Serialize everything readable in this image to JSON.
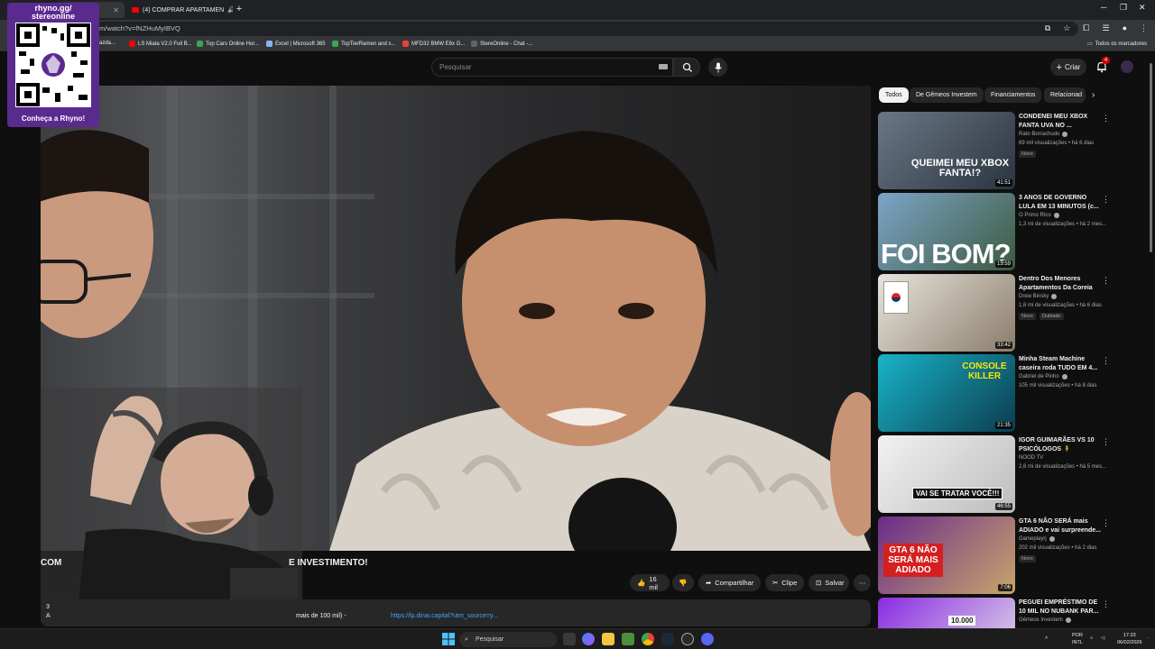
{
  "browser": {
    "tabs": [
      {
        "label": "",
        "active": true
      },
      {
        "label": "(4) COMPRAR APARTAMEN",
        "active": false
      }
    ],
    "url": "m/watch?v=fNZHuMyIBVQ",
    "bookmarks": [
      {
        "label": "azda...",
        "color": "#4285f4"
      },
      {
        "label": "LS Miata V2.0 Full B...",
        "color": "#ff0000"
      },
      {
        "label": "Top Cars Online Hor...",
        "color": "#34a853"
      },
      {
        "label": "Excel | Microsoft 365",
        "color": "#8ab4f8"
      },
      {
        "label": "TopTierRamen and s...",
        "color": "#34a853"
      },
      {
        "label": "MFD32 BMW E8x G...",
        "color": "#ea4335"
      },
      {
        "label": "StereOnline - Chat -...",
        "color": "#5f6368"
      }
    ],
    "all_bookmarks": "Todos os marcadores"
  },
  "overlay": {
    "qr_title_line1": "rhyno.gg/",
    "qr_title_line2": "stereonline",
    "qr_cta": "Conheça a Rhyno!"
  },
  "youtube": {
    "search_placeholder": "Pesquisar",
    "create_label": "Criar",
    "notifications_count": "4",
    "video": {
      "title_start": "COM",
      "title_end": "E INVESTIMENTO!",
      "likes": "16 mil",
      "share": "Compartilhar",
      "clip": "Clipe",
      "save": "Salvar",
      "desc_line1_prefix": "3",
      "desc_line2_prefix": "A",
      "desc_mid": "mais de 100 mil) -",
      "desc_link": "https://lp.dinai.capital?utm_source=y..."
    },
    "chips": [
      "Todos",
      "De Gêmeos Investem",
      "Financiamentos",
      "Relacionad"
    ],
    "recommendations": [
      {
        "title": "CONDENEI MEU XBOX FANTA UVA NO ...",
        "channel": "Rato Borrachudo",
        "meta": "69 mil visualizações • há 6 dias",
        "badge": "Novo",
        "badge2": "",
        "duration": "41:51",
        "thumb_text": "QUEIMEI MEU XBOX FANTA!?"
      },
      {
        "title": "3 ANOS DE GOVERNO LULA EM 13 MINUTOS (c...",
        "channel": "O Primo Rico",
        "meta": "1,3 mi de visualizações • há 2 mes...",
        "badge": "",
        "badge2": "",
        "duration": "13:59",
        "thumb_text": "FOI BOM?"
      },
      {
        "title": "Dentro Dos Menores Apartamentos Da Coreia",
        "channel": "Drew Binsky",
        "meta": "1,6 mi de visualizações • há 6 dias",
        "badge": "Novo",
        "badge2": "Dublado",
        "duration": "33:42",
        "thumb_text": ""
      },
      {
        "title": "Minha Steam Machine caseira roda TUDO EM 4...",
        "channel": "Gabriel de Pinho",
        "meta": "105 mil visualizações • há 8 dias",
        "badge": "",
        "badge2": "",
        "duration": "21:35",
        "thumb_text": "CONSOLE KILLER"
      },
      {
        "title": "IGOR GUIMARÃES VS 10 PSICÓLOGOS 🧍",
        "channel": "NOOD TV",
        "meta": "2,6 mi de visualizações • há 5 mes...",
        "badge": "",
        "badge2": "",
        "duration": "46:55",
        "thumb_text": "VAI SE TRATAR VOCÊ!!!"
      },
      {
        "title": "GTA 6 NÃO SERÁ mais ADIADO e vai surpreende...",
        "channel": "Gameplayrj",
        "meta": "202 mil visualizações • há 2 dias",
        "badge": "Novo",
        "badge2": "",
        "duration": "7:06",
        "thumb_text": "GTA 6 NÃO SERÁ MAIS ADIADO"
      },
      {
        "title": "PEGUEI EMPRÉSTIMO DE 10 MIL NO NUBANK PAR...",
        "channel": "Gêmeos Investem",
        "meta": "",
        "badge": "",
        "badge2": "",
        "duration": "",
        "thumb_text": "10.000"
      }
    ]
  },
  "taskbar": {
    "search_placeholder": "Pesquisar",
    "lang_line1": "POR",
    "lang_line2": "INTL",
    "time": "17:33",
    "date": "06/02/2026"
  }
}
